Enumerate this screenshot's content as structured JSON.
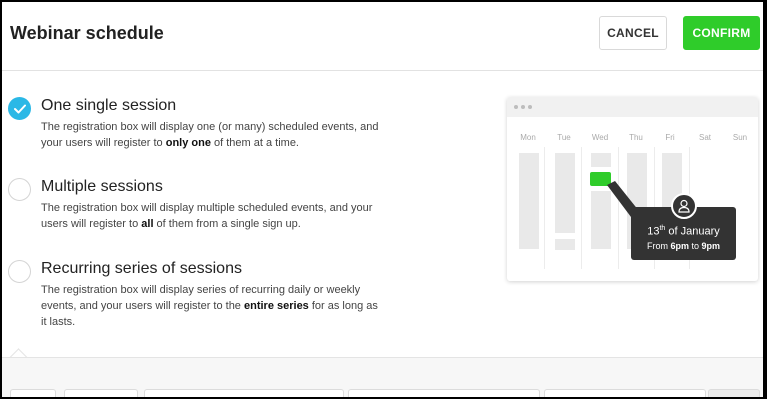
{
  "header": {
    "title": "Webinar schedule",
    "cancel_label": "CANCEL",
    "confirm_label": "CONFIRM"
  },
  "options": [
    {
      "title": "One single session",
      "checked": true,
      "desc_before": "The registration box will display one (or many) scheduled events, and your users will register to ",
      "desc_bold": "only one",
      "desc_after": " of them at a time."
    },
    {
      "title": "Multiple sessions",
      "checked": false,
      "desc_before": "The registration box will display multiple scheduled events, and your users will register to ",
      "desc_bold": "all",
      "desc_after": " of them from a single sign up."
    },
    {
      "title": "Recurring series of sessions",
      "checked": false,
      "desc_before": "The registration box will display series of recurring daily or weekly events, and your users will register to the ",
      "desc_bold": "entire series",
      "desc_after": " for as long as it lasts."
    }
  ],
  "calendar": {
    "days": [
      "Mon",
      "Tue",
      "Wed",
      "Thu",
      "Fri",
      "Sat",
      "Sun"
    ],
    "tooltip": {
      "date_day": "13",
      "date_suffix": "th",
      "date_rest": " of January",
      "time_prefix": "From ",
      "time_start": "6pm",
      "time_mid": " to ",
      "time_end": "9pm"
    },
    "accent_color": "#2fcc2a"
  },
  "colors": {
    "confirm_bg": "#2fcc2a",
    "radio_checked": "#2bb8e6"
  },
  "icons": {
    "check": "check-icon",
    "user": "user-icon"
  }
}
